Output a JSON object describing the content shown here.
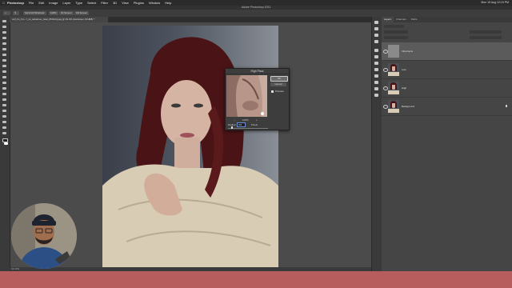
{
  "menubar": {
    "items": [
      "Photoshop",
      "File",
      "Edit",
      "Image",
      "Layer",
      "Type",
      "Select",
      "Filter",
      "3D",
      "View",
      "Plugins",
      "Window",
      "Help"
    ],
    "clock": "Mon 15 Aug 12:19 PM"
  },
  "window": {
    "title": "Adobe Photoshop 2022"
  },
  "options_bar": {
    "scroll_all": "Scroll All Windows",
    "zoom": "100%",
    "fit_screen": "Fit Screen",
    "fill_screen": "Fill Screen"
  },
  "document": {
    "tab_label": "coll_ho_frm...f_ss_tabaimse_fetal_#5f1b9.jpeg @ 33.3% (Harsisser, RGB/8) *",
    "status": "33.33%"
  },
  "layers_panel": {
    "tabs": [
      "Layers",
      "Channels",
      "Paths"
    ],
    "layers": [
      {
        "name": "Inharmons",
        "selected": true
      },
      {
        "name": "Low",
        "selected": false
      },
      {
        "name": "High",
        "selected": false
      },
      {
        "name": "Background",
        "selected": false,
        "locked": true
      }
    ]
  },
  "dialog": {
    "title": "High Pass",
    "ok": "OK",
    "cancel": "Cancel",
    "preview": "Preview",
    "zoom_level": "100%",
    "radius_label": "Radius:",
    "radius_value": "3.0",
    "units": "Pixels"
  },
  "colors": {
    "bottom_band": "#b85d5d",
    "panel_bg": "#454545",
    "menubar_bg": "#2b2b2b"
  }
}
